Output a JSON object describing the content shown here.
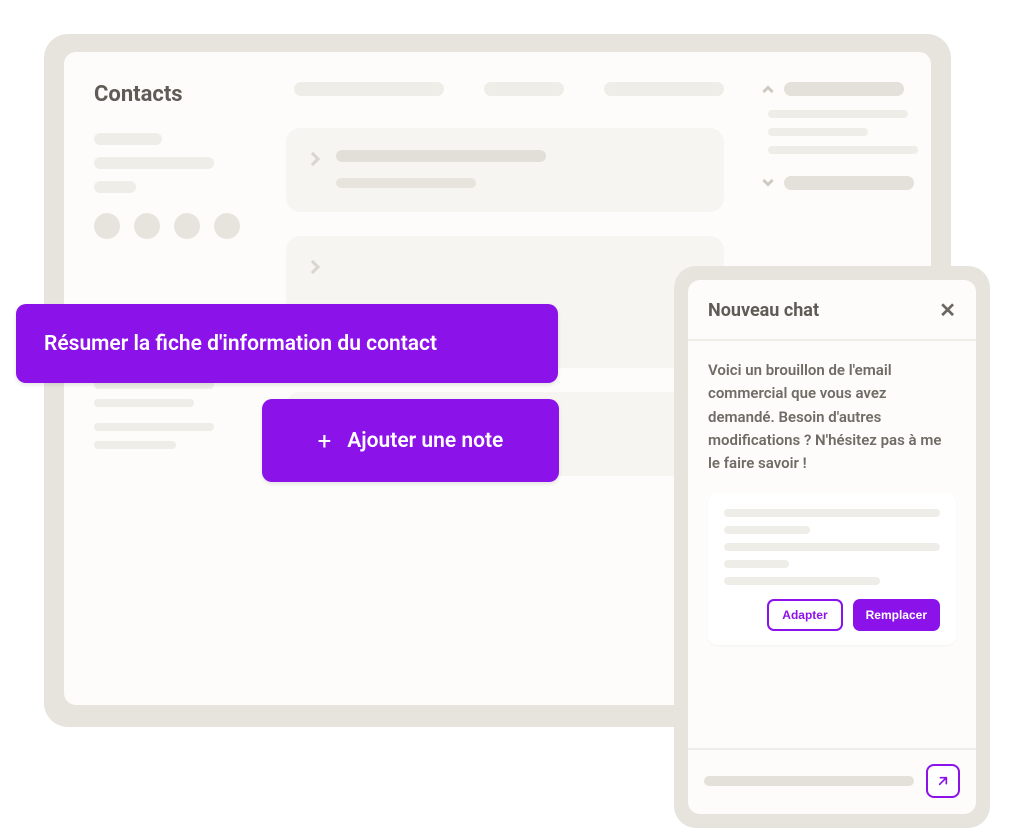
{
  "sidebar": {
    "title": "Contacts"
  },
  "actions": {
    "summarize": "Résumer la fiche d'information du contact",
    "add_note": "Ajouter une note",
    "plus": "+"
  },
  "chat": {
    "title": "Nouveau chat",
    "close": "✕",
    "message": "Voici un brouillon de l'email commercial que vous avez demandé. Besoin d'autres modifications ? N'hésitez pas à me le faire savoir !",
    "adapt": "Adapter",
    "replace": "Remplacer"
  }
}
